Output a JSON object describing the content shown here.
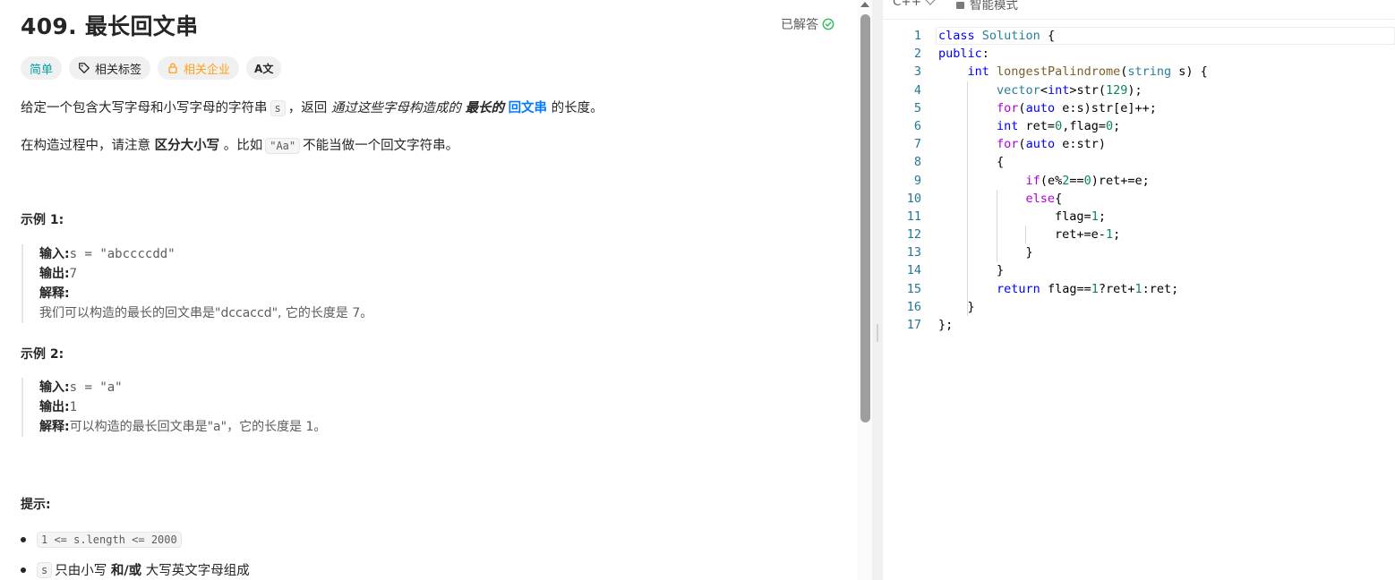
{
  "problem": {
    "title": "409. 最长回文串",
    "solved_label": "已解答",
    "tags": {
      "difficulty": "简单",
      "topics": "相关标签",
      "companies": "相关企业",
      "translate": "A文"
    },
    "description": {
      "p1_a": "给定一个包含大写字母和小写字母的字符串",
      "p1_code": "s",
      "p1_b": "，返回",
      "p1_em": "通过这些字母构造成的",
      "p1_strong": "最长的",
      "p1_link": "回文串",
      "p1_c": "的长度。",
      "p2_a": "在构造过程中，请注意",
      "p2_strong": "区分大小写",
      "p2_b": "。比如",
      "p2_code": "\"Aa\"",
      "p2_c": "不能当做一个回文字符串。"
    },
    "examples": [
      {
        "heading": "示例 1:",
        "input_label": "输入:",
        "input_value": "s = \"abccccdd\"",
        "output_label": "输出:",
        "output_value": "7",
        "explain_label": "解释:",
        "explain_text": "我们可以构造的最长的回文串是\"dccaccd\", 它的长度是 7。"
      },
      {
        "heading": "示例 2:",
        "input_label": "输入:",
        "input_value": "s = \"a\"",
        "output_label": "输出:",
        "output_value": "1",
        "explain_label": "解释:",
        "explain_text": "可以构造的最长回文串是\"a\"，它的长度是 1。"
      }
    ],
    "hints_heading": "提示:",
    "hints": [
      {
        "code": "1 <= s.length <= 2000"
      },
      {
        "code": "s",
        "a": "只由小写",
        "strong": "和/或",
        "b": "大写英文字母组成"
      }
    ]
  },
  "editor": {
    "language": "C++",
    "mode": "智能模式",
    "line_numbers": [
      "1",
      "2",
      "3",
      "4",
      "5",
      "6",
      "7",
      "8",
      "9",
      "10",
      "11",
      "12",
      "13",
      "14",
      "15",
      "16",
      "17"
    ],
    "code_lines": [
      "class Solution {",
      "public:",
      "    int longestPalindrome(string s) {",
      "        vector<int>str(129);",
      "        for(auto e:s)str[e]++;",
      "        int ret=0,flag=0;",
      "        for(auto e:str)",
      "        {",
      "            if(e%2==0)ret+=e;",
      "            else{",
      "                flag=1;",
      "                ret+=e-1;",
      "            }",
      "        }",
      "        return flag==1?ret+1:ret;",
      "    }",
      "};"
    ]
  },
  "colors": {
    "accent_blue": "#007aff",
    "easy_teal": "#00a3a6",
    "company_orange": "#ffa116",
    "solved_green": "#2cbb5d"
  }
}
